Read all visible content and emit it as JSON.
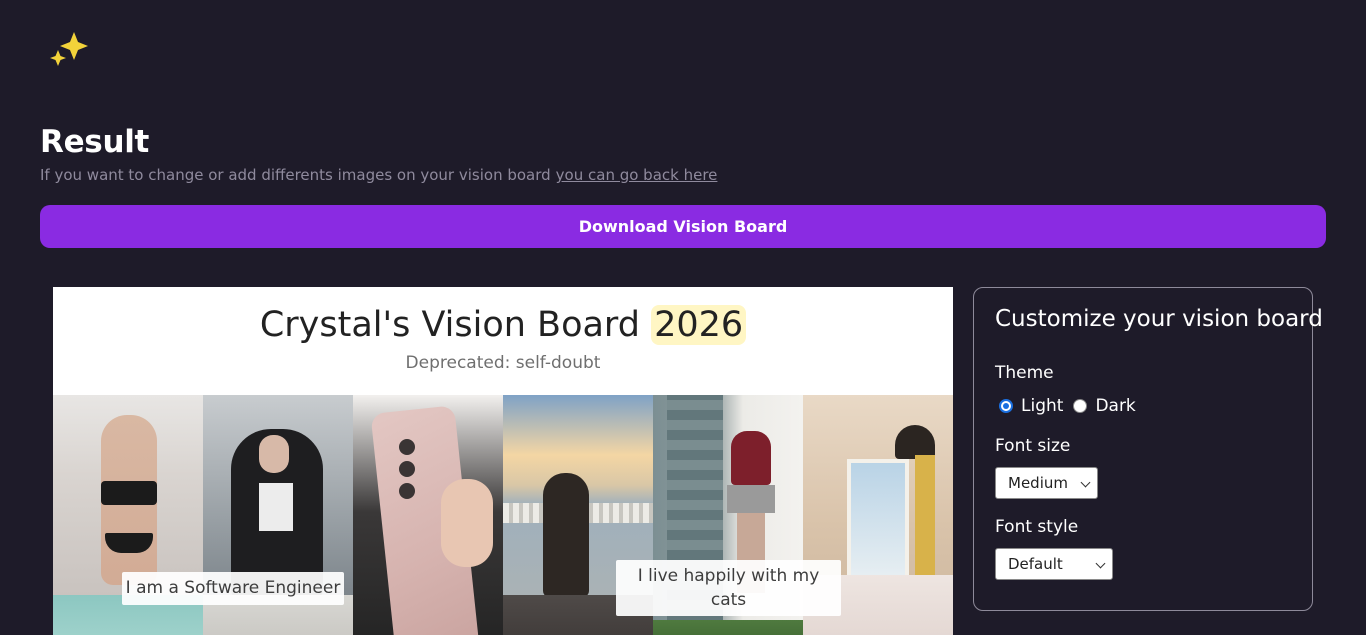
{
  "page": {
    "heading": "Result",
    "subtext": "If you want to change or add differents images on your vision board",
    "back_link": "you can go back here",
    "download_button": "Download Vision Board"
  },
  "board": {
    "title": "Crystal's Vision Board",
    "year": "2026",
    "subtitle": "Deprecated: self-doubt",
    "captions": [
      "I am a Software Engineer",
      "I live happily with my cats"
    ]
  },
  "customize": {
    "title": "Customize your vision board",
    "theme_label": "Theme",
    "theme_options": [
      "Light",
      "Dark"
    ],
    "theme_selected": "Light",
    "font_size_label": "Font size",
    "font_size_value": "Medium",
    "font_style_label": "Font style",
    "font_style_value": "Default"
  },
  "colors": {
    "background": "#1e1b29",
    "accent": "#8a2be2",
    "logo": "#f2d23a"
  }
}
